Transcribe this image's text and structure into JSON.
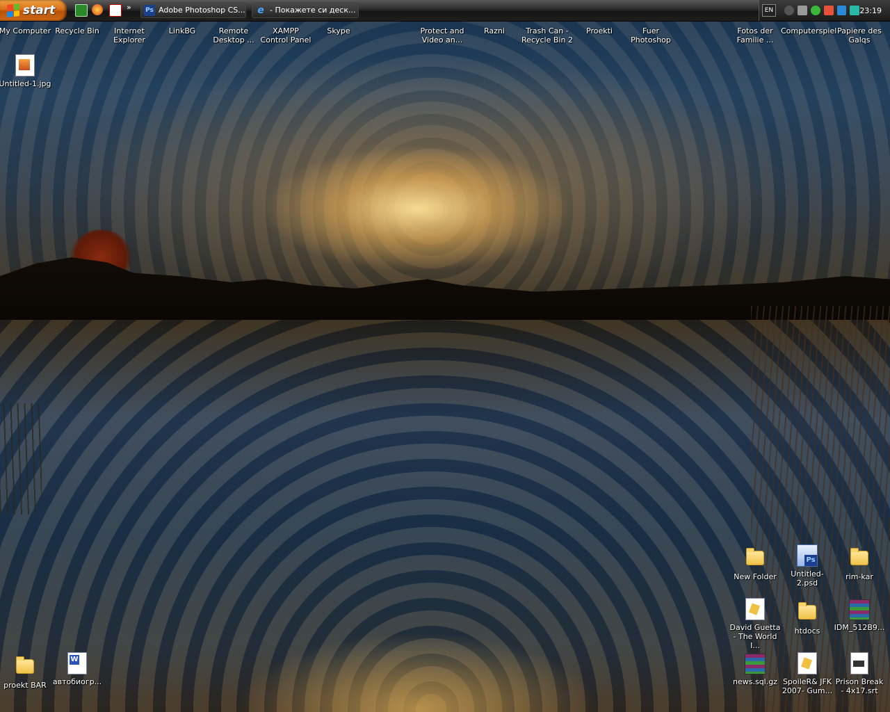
{
  "taskbar": {
    "start_label": "start",
    "quicklaunch_more": "»",
    "tasks": [
      {
        "label": "Adobe Photoshop CS...",
        "icon": "Ps"
      },
      {
        "label": "- Покажете си деск...",
        "icon": "e"
      }
    ],
    "tray": {
      "language": "EN",
      "clock": "23:19"
    }
  },
  "desktop": {
    "top_row": [
      "My Computer",
      "Recycle Bin",
      "Internet Explorer",
      "LinkBG",
      "Remote Desktop ...",
      "XAMPP Control Panel",
      "Skype",
      "Protect and Video an...",
      "Razni",
      "Trash Can - Recycle Bin 2",
      "Proekti",
      "Fuer Photoshop",
      "Fotos der Familie ...",
      "Computerspiel",
      "Papiere des Galqs"
    ],
    "untitled_jpg": "Untitled-1.jpg",
    "right_group": [
      "New Folder",
      "Untitled-2.psd",
      "rim-kar",
      "David Guetta - The World I...",
      "htdocs",
      "IDM_512B9...",
      "news.sql.gz",
      "SpoileR& JFK 2007- Gum...",
      "Prison Break - 4x17.srt"
    ],
    "bottom_left": [
      "proekt BAR",
      "автобиогр..."
    ]
  }
}
